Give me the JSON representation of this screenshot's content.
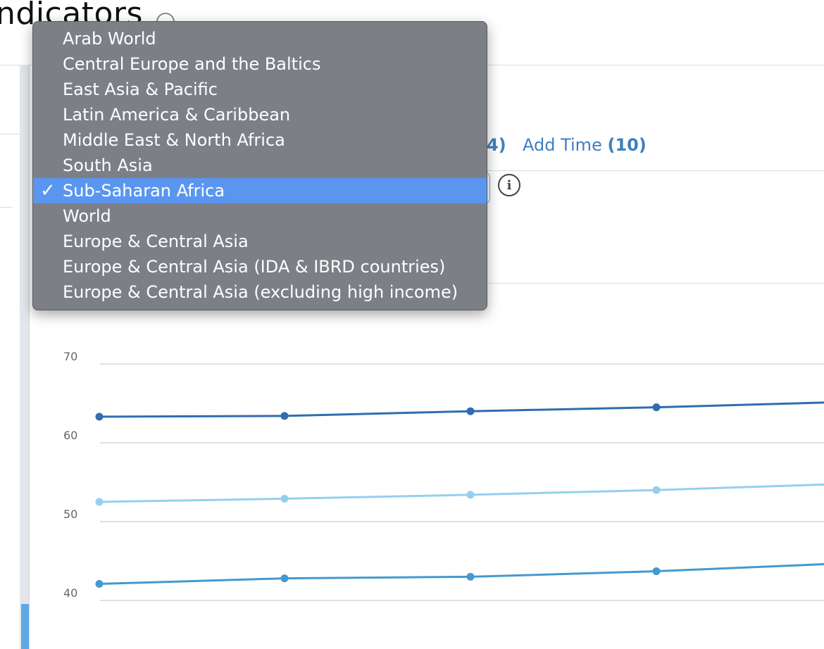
{
  "page": {
    "title": "ndicators"
  },
  "toolbar": {
    "partial_count": "4)",
    "add_time_label": "Add Time",
    "add_time_count": "(10)"
  },
  "dropdown": {
    "items": [
      {
        "label": "Arab World",
        "selected": false
      },
      {
        "label": "Central Europe and the Baltics",
        "selected": false
      },
      {
        "label": "East Asia & Pacific",
        "selected": false
      },
      {
        "label": "Latin America & Caribbean",
        "selected": false
      },
      {
        "label": "Middle East & North Africa",
        "selected": false
      },
      {
        "label": "South Asia",
        "selected": false
      },
      {
        "label": "Sub-Saharan Africa",
        "selected": true
      },
      {
        "label": "World",
        "selected": false
      },
      {
        "label": "Europe & Central Asia",
        "selected": false
      },
      {
        "label": "Europe & Central Asia (IDA & IBRD countries)",
        "selected": false
      },
      {
        "label": "Europe & Central Asia (excluding high income)",
        "selected": false
      }
    ],
    "check_mark": "✓"
  },
  "info_glyph": "i",
  "chart_data": {
    "type": "line",
    "ylim": [
      40,
      70
    ],
    "yticks": [
      "70",
      "60",
      "50",
      "40"
    ],
    "grid": true,
    "x": [
      1,
      2,
      3,
      4,
      5
    ],
    "series": [
      {
        "color": "#2f6db0",
        "values": [
          63.3,
          63.4,
          64.0,
          64.5,
          65.1
        ]
      },
      {
        "color": "#94d0ee",
        "values": [
          52.5,
          52.9,
          53.4,
          54.0,
          54.7
        ]
      },
      {
        "color": "#4499d2",
        "values": [
          42.1,
          42.8,
          43.0,
          43.7,
          44.6
        ]
      }
    ]
  }
}
